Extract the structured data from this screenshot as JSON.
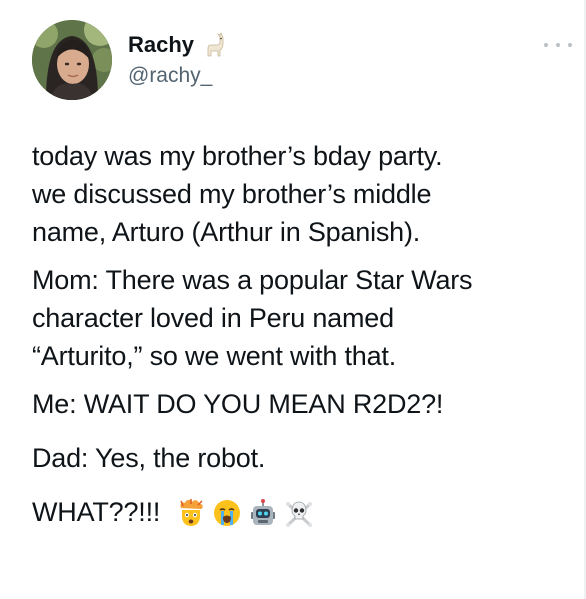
{
  "user": {
    "display_name": "Rachy",
    "handle": "@rachy_",
    "name_badge_icon": "llama-emoji-icon"
  },
  "tweet": {
    "paragraphs": [
      [
        "today was my brother’s bday party.",
        "we discussed my brother’s middle",
        "name, Arturo (Arthur in Spanish)."
      ],
      [
        "Mom: There was a popular Star Wars",
        "character loved in Peru named",
        "“Arturito,” so we went with that."
      ],
      [
        "Me: WAIT DO YOU MEAN R2D2?!"
      ],
      [
        "Dad: Yes, the robot."
      ],
      [
        "WHAT??!!!"
      ]
    ],
    "trailing_emojis": [
      "exploding-head-emoji-icon",
      "loudly-crying-face-emoji-icon",
      "robot-face-emoji-icon",
      "skull-and-crossbones-emoji-icon"
    ]
  },
  "colors": {
    "text": "#0f1419",
    "secondary": "#536471",
    "background": "#ffffff"
  }
}
